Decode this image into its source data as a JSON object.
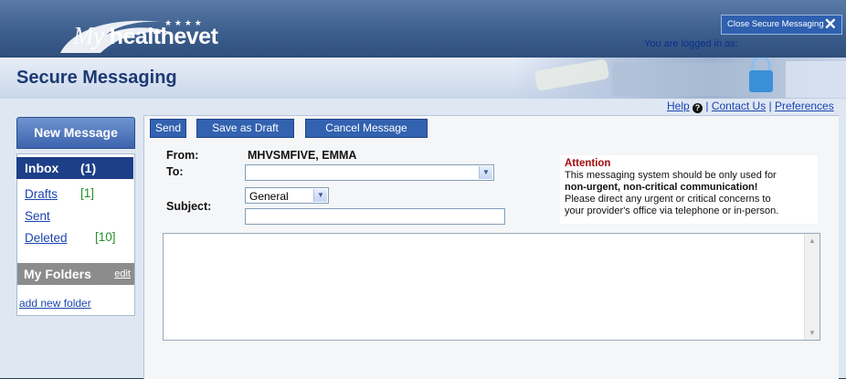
{
  "header": {
    "logo_text_my": "My",
    "logo_text_brand": "healthevet",
    "close_button_label": "Close Secure Messaging",
    "logged_in_text": "You are logged in as:",
    "page_title": "Secure Messaging"
  },
  "help_links": {
    "help": "Help",
    "separator1": "|",
    "contact": "Contact Us",
    "separator2": "|",
    "preferences": "Preferences"
  },
  "nav": {
    "new_message": "New Message",
    "folders": [
      {
        "label": "Inbox",
        "count": "(1)"
      },
      {
        "label": "Drafts",
        "count": "[1]"
      },
      {
        "label": "Sent",
        "count": ""
      },
      {
        "label": "Deleted",
        "count": "[10]"
      }
    ],
    "my_folders_title": "My Folders",
    "my_folders_edit": "edit",
    "add_folder": "add new folder"
  },
  "toolbar": {
    "send": "Send",
    "save_draft": "Save as Draft",
    "cancel": "Cancel Message"
  },
  "form": {
    "from_label": "From:",
    "from_value": "MHVSMFIVE, EMMA",
    "to_label": "To:",
    "to_value": "",
    "subject_label": "Subject:",
    "category_value": "General",
    "subject_value": "",
    "body_value": ""
  },
  "attention": {
    "title": "Attention",
    "line1": "This messaging system should be only used for",
    "line2": "non-urgent, non-critical communication!",
    "line3": "Please direct any urgent or critical concerns to",
    "line4": "your provider's office via telephone or in-person."
  }
}
